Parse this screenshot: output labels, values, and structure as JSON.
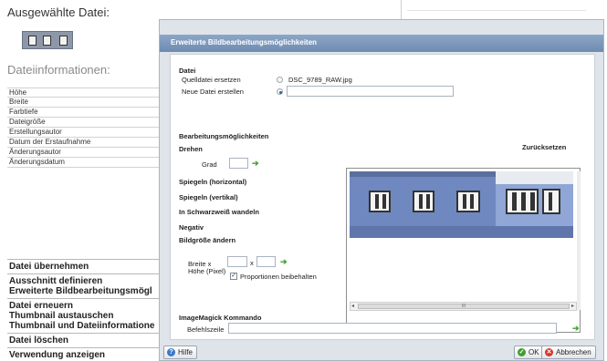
{
  "background": {
    "title": "Ausgewählte Datei:",
    "info_title": "Dateiinformationen:",
    "info_rows": [
      "Höhe",
      "Breite",
      "Farbtiefe",
      "Dateigröße",
      "Erstellungsautor",
      "Datum der Erstaufnahme",
      "Änderungsautor",
      "Änderungsdatum"
    ],
    "actions": [
      [
        "Datei übernehmen"
      ],
      [
        "Ausschnitt definieren",
        "Erweiterte Bildbearbeitungsmögl"
      ],
      [
        "Datei erneuern",
        "Thumbnail austauschen",
        "Thumbnail und Dateiinformatione"
      ],
      [
        "Datei löschen"
      ],
      [
        "Verwendung anzeigen"
      ]
    ]
  },
  "dialog": {
    "title": "Erweiterte Bildbearbeitungsmöglichkeiten",
    "file_section": "Datei",
    "replace_source_label": "Quelldatei ersetzen",
    "source_filename": "DSC_9789_RAW.jpg",
    "new_file_label": "Neue Datei erstellen",
    "new_file_value": "",
    "options_section": "Bearbeitungsmöglichkeiten",
    "reset_label": "Zurücksetzen",
    "rotate_label": "Drehen",
    "degree_label": "Grad",
    "degree_value": "",
    "mirror_h": "Spiegeln (horizontal)",
    "mirror_v": "Spiegeln (vertikal)",
    "grayscale": "In Schwarzweiß wandeln",
    "negative": "Negativ",
    "resize": "Bildgröße ändern",
    "width_label": "Breite x",
    "height_label": "Höhe (Pixel)",
    "x_sep": "x",
    "width_value": "",
    "height_value": "",
    "keep_ratio_label": "Proportionen beibehalten",
    "keep_ratio_checked": true,
    "imagemagick_section": "ImageMagick Kommando",
    "command_label": "Befehlszeile",
    "command_value": "",
    "scroll_grip": "III",
    "help_button": "Hilfe",
    "ok_button": "OK",
    "cancel_button": "Abbrechen"
  },
  "colors": {
    "titlebar": "#6e8bb1",
    "ok_icon": "#3fa12c",
    "cancel_icon": "#d9342b",
    "help_icon": "#3a78c9"
  }
}
